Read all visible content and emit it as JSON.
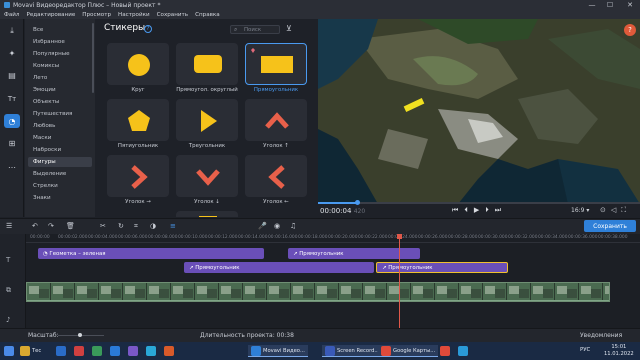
{
  "window": {
    "title": "Movavi Видеоредактор Плюс – Новый проект *",
    "controls": {
      "minimize": "—",
      "maximize": "☐",
      "close": "✕"
    }
  },
  "menu": [
    "Файл",
    "Редактирование",
    "Просмотр",
    "Настройки",
    "Сохранить",
    "Справка"
  ],
  "rail": [
    {
      "icon": "import-icon",
      "glyph": "⤓"
    },
    {
      "icon": "pin-icon",
      "glyph": "✦"
    },
    {
      "icon": "filters-icon",
      "glyph": "▤"
    },
    {
      "icon": "text-icon",
      "glyph": "Tт"
    },
    {
      "icon": "stickers-icon",
      "glyph": "◔",
      "active": true
    },
    {
      "icon": "transitions-icon",
      "glyph": "⊞"
    },
    {
      "icon": "more-icon",
      "glyph": "…"
    }
  ],
  "categories": [
    {
      "label": "Все"
    },
    {
      "label": "Избранное"
    },
    {
      "label": "Популярные"
    },
    {
      "label": "Комиксы"
    },
    {
      "label": "Лето"
    },
    {
      "label": "Эмоции"
    },
    {
      "label": "Объекты"
    },
    {
      "label": "Путешествия"
    },
    {
      "label": "Любовь"
    },
    {
      "label": "Маски"
    },
    {
      "label": "Наброски"
    },
    {
      "label": "Фигуры",
      "active": true
    },
    {
      "label": "Выделение"
    },
    {
      "label": "Стрелки"
    },
    {
      "label": "Знаки"
    }
  ],
  "stickers": {
    "title": "Стикеры",
    "help": "?",
    "search_placeholder": "Поиск",
    "items": [
      {
        "label": "Круг",
        "shape": "circle"
      },
      {
        "label": "Прямоугол. округлый",
        "shape": "rounded-rect"
      },
      {
        "label": "Прямоугольник",
        "shape": "rect",
        "selected": true,
        "favorite": true
      },
      {
        "label": "Пятиугольник",
        "shape": "pentagon"
      },
      {
        "label": "Треугольник",
        "shape": "triangle"
      },
      {
        "label": "Уголок ↑",
        "shape": "chevron-up"
      },
      {
        "label": "Уголок →",
        "shape": "chevron-right"
      },
      {
        "label": "Уголок ↓",
        "shape": "chevron-down"
      },
      {
        "label": "Уголок ←",
        "shape": "chevron-left"
      }
    ]
  },
  "preview": {
    "help": "?",
    "time_current": "00:00:04",
    "time_frames": "420",
    "progress": 0.12,
    "aspect": "16:9 ▾"
  },
  "toolbar": {
    "save_label": "Сохранить"
  },
  "timeline": {
    "ticks": [
      "00:00:00",
      "00:00:02.000",
      "00:00:04.000",
      "00:00:06.000",
      "00:00:08.000",
      "00:00:10.000",
      "00:00:12.000",
      "00:00:14.000",
      "00:00:16.000",
      "00:00:18.000",
      "00:00:20.000",
      "00:00:22.000",
      "00:00:24.000",
      "00:00:26.000",
      "00:00:28.000",
      "00:00:30.000",
      "00:00:32.000",
      "00:00:34.000",
      "00:00:36.000",
      "00:00:38.000"
    ],
    "clips": [
      {
        "label": "Геометка – зеленая"
      },
      {
        "label": "Прямоугольник"
      },
      {
        "label": "Прямоугольник"
      },
      {
        "label": "Прямоугольник",
        "selected": true
      }
    ]
  },
  "status": {
    "scale_label": "Масштаб:",
    "duration": "Длительность проекта: 00:38",
    "notifications": "Уведомления"
  },
  "taskbar": {
    "apps": [
      {
        "label": "Тес",
        "color": "#d8a830"
      },
      {
        "label": "",
        "color": "#2a6cc8"
      },
      {
        "label": "",
        "color": "#d04040"
      },
      {
        "label": "",
        "color": "#3a9a5a"
      },
      {
        "label": "",
        "color": "#2a7ad8"
      },
      {
        "label": "",
        "color": "#7a58c8"
      },
      {
        "label": "",
        "color": "#2aa8d8"
      },
      {
        "label": "",
        "color": "#d85a2a"
      },
      {
        "label": "Movavi Видео...",
        "color": "#2f80d8",
        "open": true
      },
      {
        "label": "Screen Record...",
        "color": "#3a5ab8",
        "open": true
      },
      {
        "label": "Google Карты...",
        "color": "#e04a3a",
        "open": true
      },
      {
        "label": "",
        "color": "#e04a3a"
      },
      {
        "label": "",
        "color": "#2a9ad8"
      }
    ],
    "lang": "РУС",
    "time": "15:01",
    "date": "11.01.2022"
  }
}
